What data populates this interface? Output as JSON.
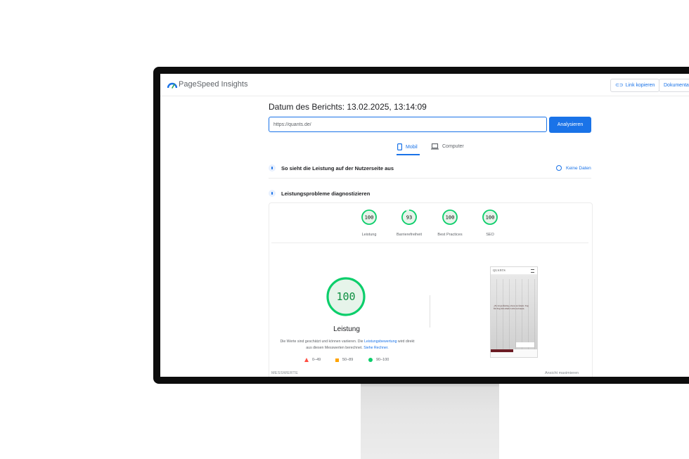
{
  "header": {
    "brand": "PageSpeed Insights",
    "link_copy": "Link kopieren",
    "docs": "Dokumentatio"
  },
  "report": {
    "date": "Datum des Berichts: 13.02.2025, 13:14:09",
    "url_value": "https://quants.de/",
    "analyze": "Analysieren"
  },
  "tabs": {
    "mobile": "Mobil",
    "desktop": "Computer"
  },
  "sections": {
    "field": "So sieht die Leistung auf der Nutzerseite aus",
    "no_data": "Keine Daten",
    "diagnose": "Leistungsprobleme diagnostizieren"
  },
  "scores": [
    {
      "value": "100",
      "label": "Leistung",
      "fraction": 1.0
    },
    {
      "value": "93",
      "label": "Barrierefreiheit",
      "fraction": 0.93
    },
    {
      "value": "100",
      "label": "Best Practices",
      "fraction": 1.0
    },
    {
      "value": "100",
      "label": "SEO",
      "fraction": 1.0
    }
  ],
  "performance": {
    "score": "100",
    "label": "Leistung",
    "desc_1": "Die Werte sind geschätzt und können variieren. Die",
    "desc_link": "Leistungsbewertung",
    "desc_2": "wird direkt aus diesen Messwerten berechnet.",
    "desc_link2": "Siehe Rechner."
  },
  "legend": {
    "bad": "0–49",
    "mid": "50–89",
    "good": "90–100"
  },
  "preview": {
    "logo": "QUANTS",
    "quote": "„Es ist großartig, etwas zu feiern. Tag für Tag mit allem Licht zu bauen."
  },
  "footer": {
    "left": "MESSWERTE",
    "right": "Ansicht maximieren"
  },
  "colors": {
    "accent": "#1a73e8",
    "good": "#0cce6b",
    "mid": "#ffa400",
    "bad": "#ff4e42"
  }
}
